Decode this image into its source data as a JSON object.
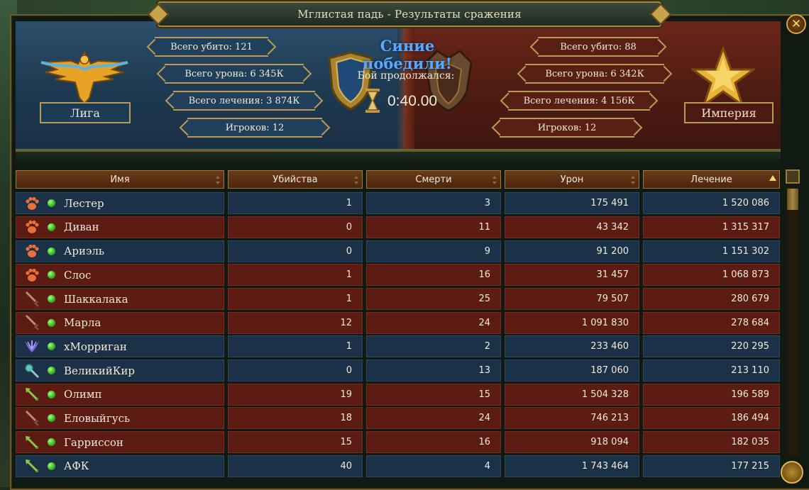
{
  "title": "Мглистая падь - Результаты сражения",
  "result": {
    "winner_text": "Синие победили!",
    "duration_label": "Бой продолжался:",
    "duration": "0:40.00"
  },
  "league": {
    "name": "Лига",
    "kills": "Всего убито: 121",
    "damage": "Всего урона: 6 345К",
    "healing": "Всего лечения: 3 874К",
    "players": "Игроков: 12"
  },
  "empire": {
    "name": "Империя",
    "kills": "Всего убито: 88",
    "damage": "Всего урона: 6 342К",
    "healing": "Всего лечения: 4 156К",
    "players": "Игроков: 12"
  },
  "columns": [
    "Имя",
    "Убийства",
    "Смерти",
    "Урон",
    "Лечение"
  ],
  "colors": {
    "blue_row": "#1b3147",
    "red_row": "#5c1b13",
    "winner": "#58a8ff",
    "gold": "#b99a56"
  },
  "rows": [
    {
      "team": "blue",
      "icon": "paw-icon",
      "name": "Лестер",
      "kills": "1",
      "deaths": "3",
      "damage": "175 491",
      "healing": "1 520 086"
    },
    {
      "team": "red",
      "icon": "paw-icon",
      "name": "Диван",
      "kills": "0",
      "deaths": "11",
      "damage": "43 342",
      "healing": "1 315 317"
    },
    {
      "team": "blue",
      "icon": "paw-icon",
      "name": "Ариэль",
      "kills": "0",
      "deaths": "9",
      "damage": "91 200",
      "healing": "1 151 302"
    },
    {
      "team": "red",
      "icon": "paw-icon",
      "name": "Слос",
      "kills": "1",
      "deaths": "16",
      "damage": "31 457",
      "healing": "1 068 873"
    },
    {
      "team": "red",
      "icon": "sword-icon",
      "name": "Шаккалака",
      "kills": "1",
      "deaths": "25",
      "damage": "79 507",
      "healing": "280 679"
    },
    {
      "team": "red",
      "icon": "sword-icon",
      "name": "Марла",
      "kills": "12",
      "deaths": "24",
      "damage": "1 091 830",
      "healing": "278 684"
    },
    {
      "team": "blue",
      "icon": "claw-icon",
      "name": "хМорриган",
      "kills": "1",
      "deaths": "2",
      "damage": "233 460",
      "healing": "220 295"
    },
    {
      "team": "blue",
      "icon": "staff-icon",
      "name": "ВеликийКир",
      "kills": "0",
      "deaths": "13",
      "damage": "187 060",
      "healing": "213 110"
    },
    {
      "team": "red",
      "icon": "arrow-icon",
      "name": "Олимп",
      "kills": "19",
      "deaths": "15",
      "damage": "1 504 328",
      "healing": "196 589"
    },
    {
      "team": "red",
      "icon": "sword-icon",
      "name": "Еловыйгусь",
      "kills": "18",
      "deaths": "24",
      "damage": "746 213",
      "healing": "186 494"
    },
    {
      "team": "red",
      "icon": "arrow-icon",
      "name": "Гарриссон",
      "kills": "15",
      "deaths": "16",
      "damage": "918 094",
      "healing": "182 035"
    },
    {
      "team": "blue",
      "icon": "arrow-icon",
      "name": "АФК",
      "kills": "40",
      "deaths": "4",
      "damage": "1 743 464",
      "healing": "177 215"
    }
  ]
}
